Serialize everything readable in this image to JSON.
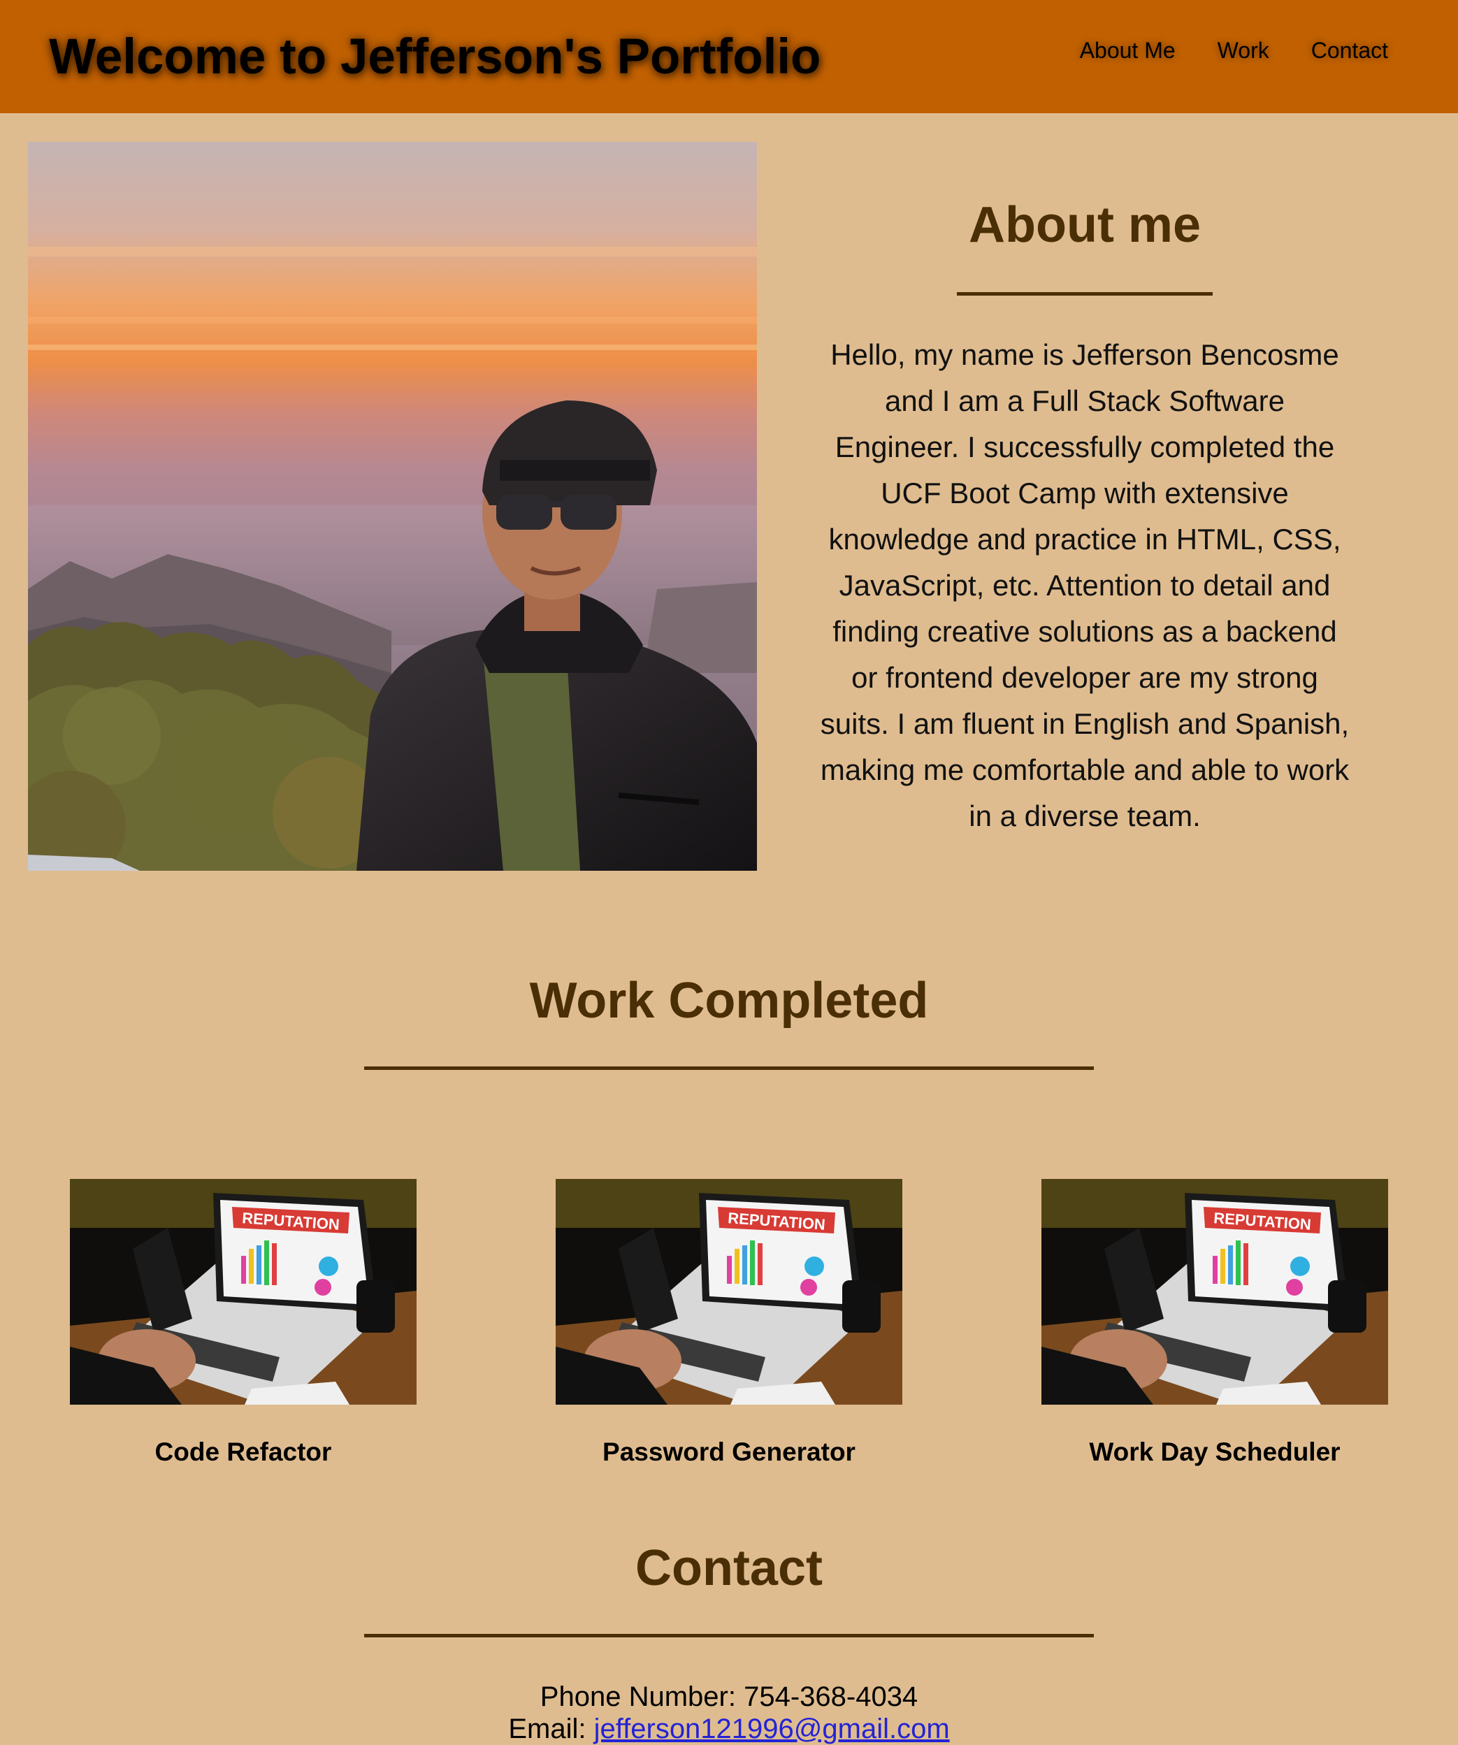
{
  "header": {
    "title": "Welcome to Jefferson's Portfolio",
    "nav": [
      "About Me",
      "Work",
      "Contact"
    ]
  },
  "about": {
    "heading": "About me",
    "text": "Hello, my name is Jefferson Bencosme and I am a Full Stack Software Engineer. I successfully completed the UCF Boot Camp with extensive knowledge and practice in HTML, CSS, JavaScript, etc. Attention to detail and finding creative solutions as a backend or frontend developer are my strong suits. I am fluent in English and Spanish, making me comfortable and able to work in a diverse team."
  },
  "work": {
    "heading": "Work Completed",
    "projects": [
      {
        "title": "Code Refactor",
        "screen_label": "REPUTATION"
      },
      {
        "title": "Password Generator",
        "screen_label": "REPUTATION"
      },
      {
        "title": "Work Day Scheduler",
        "screen_label": "REPUTATION"
      }
    ]
  },
  "contact": {
    "heading": "Contact",
    "phone_label": "Phone Number:",
    "phone": "754-368-4034",
    "email_label": "Email:",
    "email": "jefferson121996@gmail.com"
  },
  "colors": {
    "page_background": "#dfbc8f",
    "header_background": "#c06000",
    "heading_color": "#4a2e05",
    "link_color": "#2323d6"
  },
  "icons": [
    "portrait-photo",
    "laptop-project-photo"
  ]
}
